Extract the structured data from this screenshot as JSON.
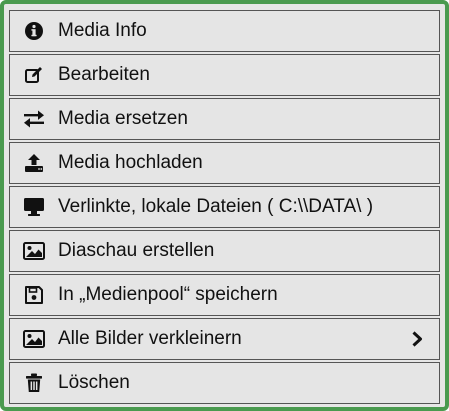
{
  "menu": {
    "items": [
      {
        "label": "Media Info",
        "icon": "info-circle-icon"
      },
      {
        "label": "Bearbeiten",
        "icon": "edit-icon"
      },
      {
        "label": "Media ersetzen",
        "icon": "swap-arrows-icon"
      },
      {
        "label": "Media hochladen",
        "icon": "upload-icon"
      },
      {
        "label": "Verlinkte, lokale Dateien ( C:\\\\DATA\\ )",
        "icon": "monitor-icon"
      },
      {
        "label": "Diaschau erstellen",
        "icon": "image-icon"
      },
      {
        "label": "In „Medienpool“ speichern",
        "icon": "save-icon"
      },
      {
        "label": "Alle Bilder verkleinern",
        "icon": "image-icon",
        "has_submenu": true,
        "submenu_icon": "chevron-right-icon"
      },
      {
        "label": "Löschen",
        "icon": "trash-icon"
      }
    ]
  },
  "colors": {
    "border_accent": "#4a9a4f",
    "item_background": "#e5e5e5",
    "item_border": "#555555",
    "text": "#111111"
  }
}
